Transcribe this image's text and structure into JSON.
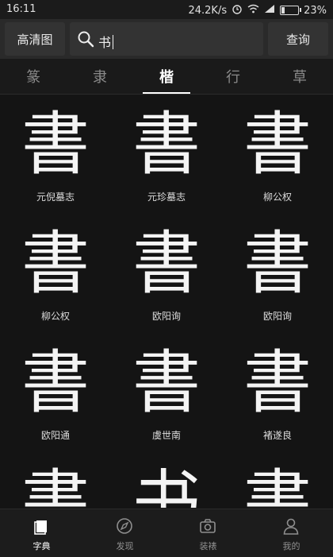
{
  "status_bar": {
    "time": "16:11",
    "net_speed": "24.2K/s",
    "battery": "23%"
  },
  "header": {
    "hd_button": "高清图",
    "search_value": "书",
    "query_button": "查询"
  },
  "tabs": [
    {
      "label": "篆",
      "active": false
    },
    {
      "label": "隶",
      "active": false
    },
    {
      "label": "楷",
      "active": true
    },
    {
      "label": "行",
      "active": false
    },
    {
      "label": "草",
      "active": false
    }
  ],
  "results": [
    {
      "glyph": "書",
      "author": "元倪墓志"
    },
    {
      "glyph": "書",
      "author": "元珍墓志"
    },
    {
      "glyph": "書",
      "author": "柳公权"
    },
    {
      "glyph": "書",
      "author": "柳公权"
    },
    {
      "glyph": "書",
      "author": "欧阳询"
    },
    {
      "glyph": "書",
      "author": "欧阳询"
    },
    {
      "glyph": "書",
      "author": "欧阳通"
    },
    {
      "glyph": "書",
      "author": "虞世南"
    },
    {
      "glyph": "書",
      "author": "褚遂良"
    },
    {
      "glyph": "書",
      "author": ""
    },
    {
      "glyph": "书",
      "author": ""
    },
    {
      "glyph": "書",
      "author": ""
    }
  ],
  "bottom_nav": [
    {
      "label": "字典",
      "icon": "book-icon",
      "active": true
    },
    {
      "label": "发现",
      "icon": "compass-icon",
      "active": false
    },
    {
      "label": "装裱",
      "icon": "camera-icon",
      "active": false
    },
    {
      "label": "我的",
      "icon": "person-icon",
      "active": false
    }
  ]
}
